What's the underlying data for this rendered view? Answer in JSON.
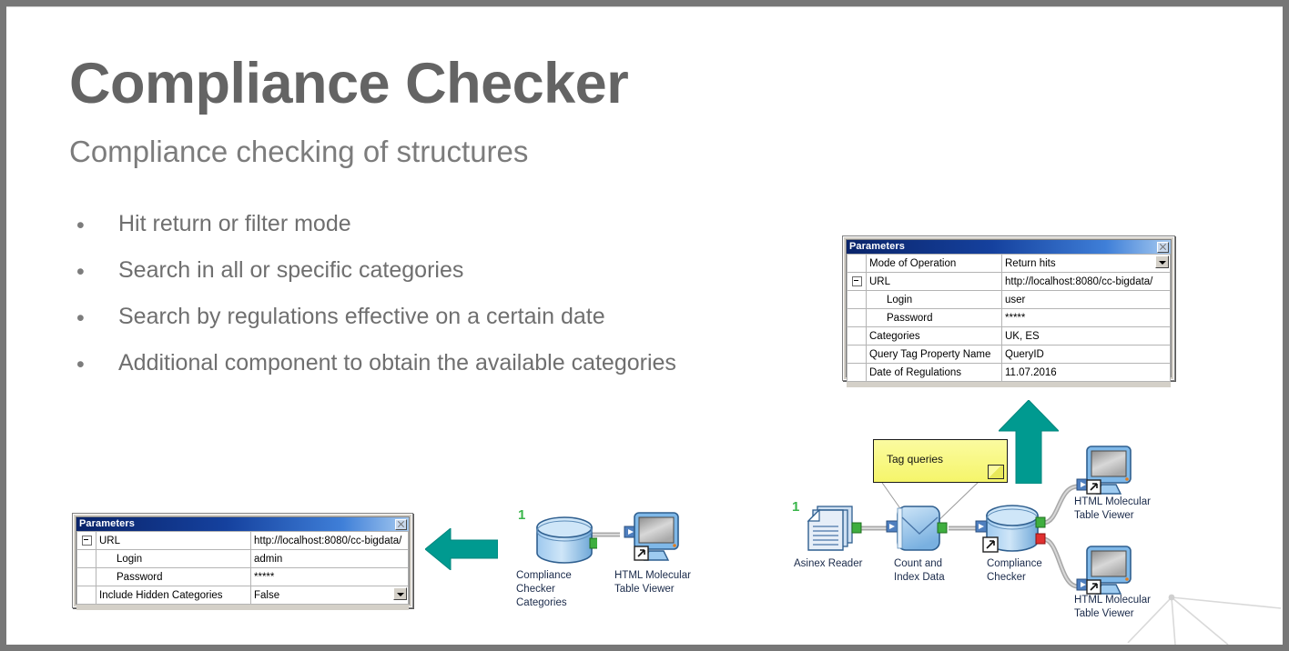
{
  "slide": {
    "title": "Compliance Checker",
    "subtitle": "Compliance checking of structures",
    "bullet_marker": "•",
    "bullets": [
      "Hit return or filter mode",
      "Search in all or specific categories",
      "Search by regulations effective on a certain date",
      "Additional component to obtain the available categories"
    ]
  },
  "dialog_top": {
    "title": "Parameters",
    "close_label": "close",
    "rows": [
      {
        "gutter": "",
        "key": "Mode of Operation",
        "value": "Return hits",
        "indent": false,
        "combo": true
      },
      {
        "gutter": "expander",
        "key": "URL",
        "value": "http://localhost:8080/cc-bigdata/",
        "indent": false,
        "combo": false
      },
      {
        "gutter": "",
        "key": "Login",
        "value": "user",
        "indent": true,
        "combo": false
      },
      {
        "gutter": "",
        "key": "Password",
        "value": "*****",
        "indent": true,
        "combo": false
      },
      {
        "gutter": "",
        "key": "Categories",
        "value": "UK, ES",
        "indent": false,
        "combo": false
      },
      {
        "gutter": "",
        "key": "Query Tag Property Name",
        "value": "QueryID",
        "indent": false,
        "combo": false
      },
      {
        "gutter": "",
        "key": "Date of Regulations",
        "value": "11.07.2016",
        "indent": false,
        "combo": false
      }
    ]
  },
  "dialog_bottom": {
    "title": "Parameters",
    "close_label": "close",
    "rows": [
      {
        "gutter": "expander",
        "key": "URL",
        "value": "http://localhost:8080/cc-bigdata/",
        "indent": false,
        "combo": false
      },
      {
        "gutter": "",
        "key": "Login",
        "value": "admin",
        "indent": true,
        "combo": false
      },
      {
        "gutter": "",
        "key": "Password",
        "value": "*****",
        "indent": true,
        "combo": false
      },
      {
        "gutter": "",
        "key": "Include Hidden Categories",
        "value": "False",
        "indent": false,
        "combo": true
      }
    ]
  },
  "workflow_main": {
    "annotation": "Tag queries",
    "nodes": {
      "asinex_reader": {
        "label": "Asinex Reader",
        "badge": "1"
      },
      "count_index": {
        "label": "Count and\nIndex Data"
      },
      "compliance_checker": {
        "label": "Compliance\nChecker"
      },
      "viewer_top": {
        "label": "HTML Molecular\nTable Viewer"
      },
      "viewer_bottom": {
        "label": "HTML Molecular\nTable Viewer"
      }
    }
  },
  "workflow_small": {
    "nodes": {
      "categories": {
        "label": "Compliance\nChecker\nCategories",
        "badge": "1"
      },
      "viewer": {
        "label": "HTML Molecular\nTable Viewer"
      }
    }
  },
  "colors": {
    "title_gray": "#646464",
    "body_gray": "#6f6f6f",
    "teal_arrow": "#009a90",
    "badge_green": "#39b54a",
    "port_green": "#3fae3f",
    "port_red": "#e03030",
    "titlebar_blue": "#0a246a",
    "annotation_yellow": "#f7f77e"
  }
}
